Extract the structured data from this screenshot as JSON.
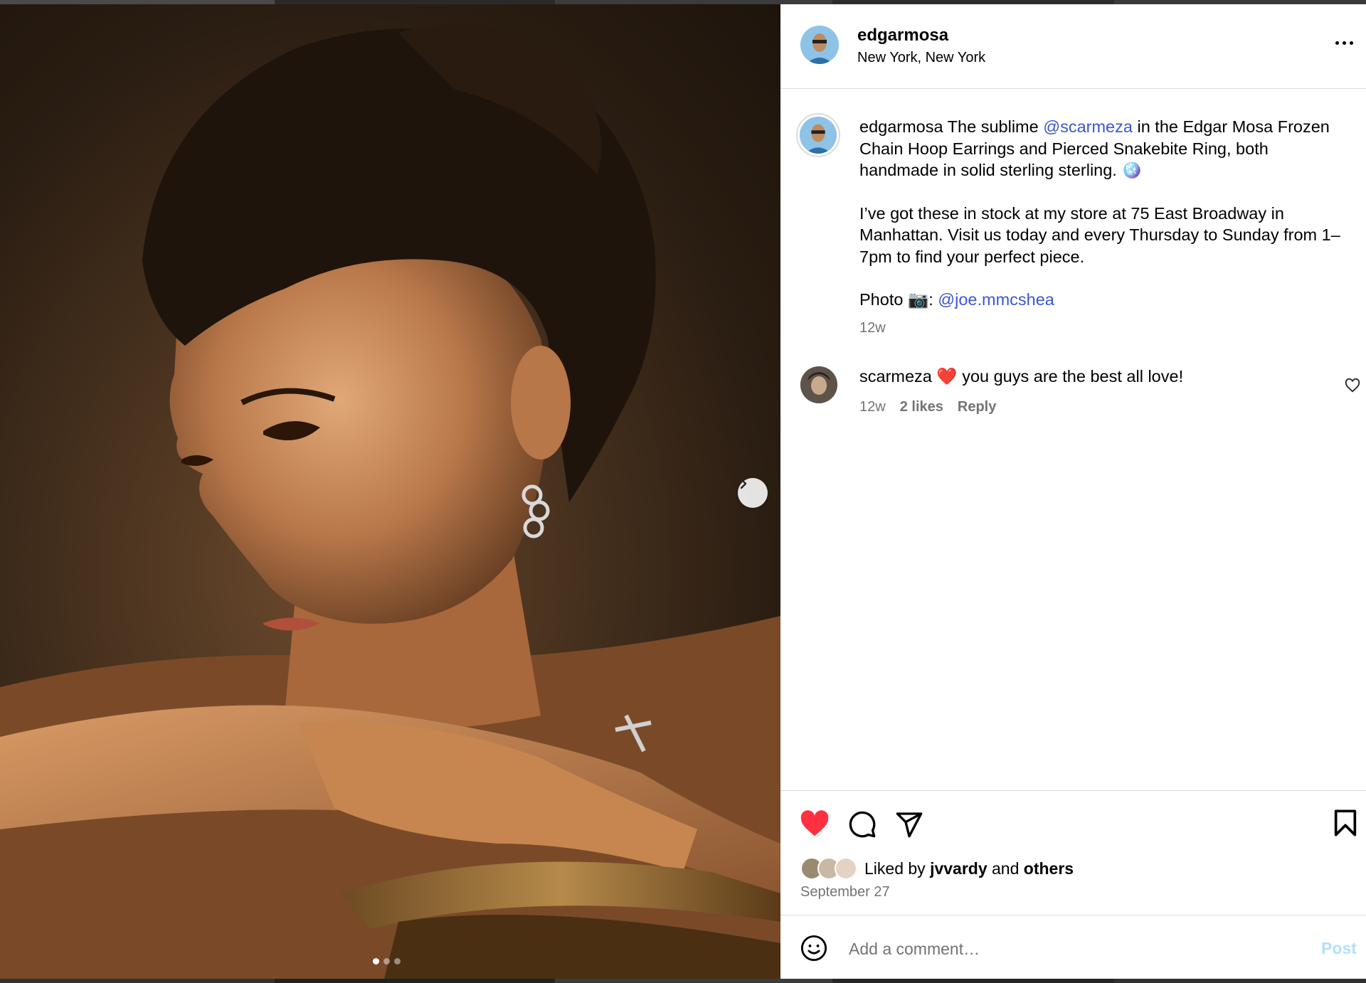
{
  "post": {
    "username": "edgarmosa",
    "location": "New York, New York",
    "caption": {
      "username": "edgarmosa",
      "text_1a": " The sublime ",
      "mention_1": "@scarmeza",
      "text_1b": " in the Edgar Mosa Frozen Chain Hoop Earrings and Pierced Snakebite Ring, both handmade in solid sterling sterling. 🪩",
      "text_2": "I’ve got these in stock at my store at 75 East Broadway in Manhattan. Visit us today and every Thursday to Sunday from 1–7pm to find your perfect piece.",
      "text_3a": "Photo 📷: ",
      "mention_2": "@joe.mmcshea",
      "time": "12w"
    },
    "comment": {
      "username": "scarmeza",
      "text": " ❤️ you guys are the best all love!",
      "time": "12w",
      "likes": "2 likes",
      "reply_label": "Reply"
    },
    "liked_by": {
      "prefix": "Liked by ",
      "user": "jvvardy",
      "middle": " and ",
      "others": "others"
    },
    "date": "September 27",
    "add_comment_placeholder": "Add a comment…",
    "post_label": "Post",
    "carousel": {
      "slides": 3,
      "current": 1
    }
  },
  "colors": {
    "like_red": "#ff3040",
    "link_blue": "#3b56d4",
    "post_disabled": "#b2dffc",
    "meta_gray": "#737373"
  },
  "icons": [
    "more-icon",
    "heart-icon",
    "comment-icon",
    "share-icon",
    "bookmark-icon",
    "emoji-icon",
    "chevron-right-icon",
    "comment-like-icon"
  ]
}
